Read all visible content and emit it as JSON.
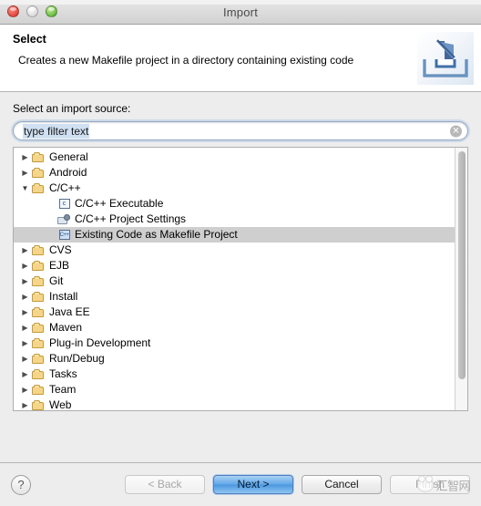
{
  "window": {
    "title": "Import",
    "traffic_lights": [
      {
        "name": "close",
        "color": "#e0443a"
      },
      {
        "name": "minimize",
        "color": "#d8d8d8"
      },
      {
        "name": "zoom",
        "color": "#62b63c"
      }
    ]
  },
  "header": {
    "title": "Select",
    "description": "Creates a new Makefile project in a directory containing existing code",
    "icon": "import-wizard-icon"
  },
  "main": {
    "source_label": "Select an import source:",
    "filter": {
      "value": "type filter text",
      "placeholder": "type filter text",
      "clear_icon": "clear-circle-icon"
    },
    "tree": [
      {
        "label": "General",
        "depth": 1,
        "icon": "folder-icon",
        "state": "collapsed",
        "selected": false
      },
      {
        "label": "Android",
        "depth": 1,
        "icon": "folder-icon",
        "state": "collapsed",
        "selected": false
      },
      {
        "label": "C/C++",
        "depth": 1,
        "icon": "folder-icon",
        "state": "expanded",
        "selected": false
      },
      {
        "label": "C/C++ Executable",
        "depth": 2,
        "icon": "c-file-icon",
        "state": "leaf",
        "selected": false,
        "glyph": "c"
      },
      {
        "label": "C/C++ Project Settings",
        "depth": 2,
        "icon": "settings-gear-icon",
        "state": "leaf",
        "selected": false
      },
      {
        "label": "Existing Code as Makefile Project",
        "depth": 2,
        "icon": "cpp-file-icon",
        "state": "leaf",
        "selected": true,
        "glyph": "C++"
      },
      {
        "label": "CVS",
        "depth": 1,
        "icon": "folder-icon",
        "state": "collapsed",
        "selected": false
      },
      {
        "label": "EJB",
        "depth": 1,
        "icon": "folder-icon",
        "state": "collapsed",
        "selected": false
      },
      {
        "label": "Git",
        "depth": 1,
        "icon": "folder-icon",
        "state": "collapsed",
        "selected": false
      },
      {
        "label": "Install",
        "depth": 1,
        "icon": "folder-icon",
        "state": "collapsed",
        "selected": false
      },
      {
        "label": "Java EE",
        "depth": 1,
        "icon": "folder-icon",
        "state": "collapsed",
        "selected": false
      },
      {
        "label": "Maven",
        "depth": 1,
        "icon": "folder-icon",
        "state": "collapsed",
        "selected": false
      },
      {
        "label": "Plug-in Development",
        "depth": 1,
        "icon": "folder-icon",
        "state": "collapsed",
        "selected": false
      },
      {
        "label": "Run/Debug",
        "depth": 1,
        "icon": "folder-icon",
        "state": "collapsed",
        "selected": false
      },
      {
        "label": "Tasks",
        "depth": 1,
        "icon": "folder-icon",
        "state": "collapsed",
        "selected": false
      },
      {
        "label": "Team",
        "depth": 1,
        "icon": "folder-icon",
        "state": "collapsed",
        "selected": false
      },
      {
        "label": "Web",
        "depth": 1,
        "icon": "folder-icon",
        "state": "collapsed",
        "selected": false
      }
    ],
    "twisty_collapsed": "▶",
    "twisty_expanded": "▼"
  },
  "footer": {
    "help_label": "?",
    "back_label": "< Back",
    "next_label": "Next >",
    "cancel_label": "Cancel",
    "finish_label": "Finish",
    "watermark_text": "汇智网"
  }
}
